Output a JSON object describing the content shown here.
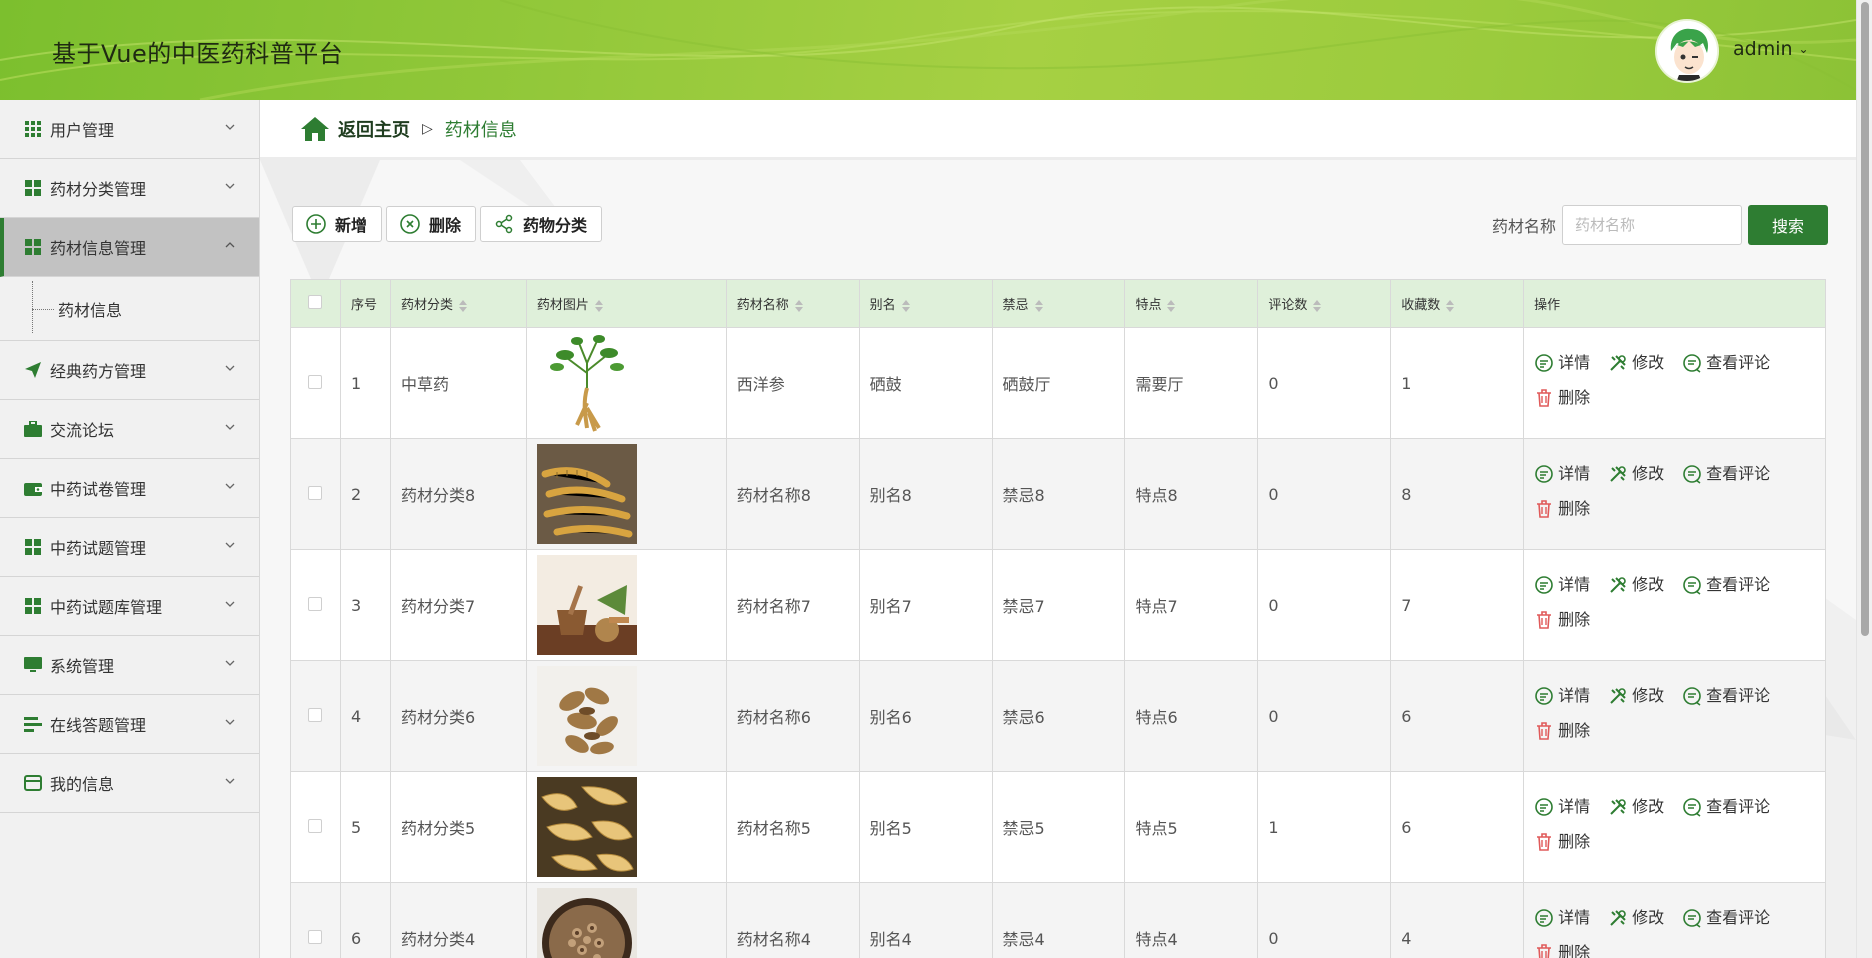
{
  "header": {
    "title": "基于Vue的中医药科普平台",
    "username": "admin"
  },
  "sidebar": {
    "items": [
      {
        "label": "用户管理",
        "icon": "grid-icon"
      },
      {
        "label": "药材分类管理",
        "icon": "grid-icon"
      },
      {
        "label": "药材信息管理",
        "icon": "grid-icon",
        "active": true
      },
      {
        "label": "经典药方管理",
        "icon": "send-icon"
      },
      {
        "label": "交流论坛",
        "icon": "briefcase-icon"
      },
      {
        "label": "中药试卷管理",
        "icon": "wallet-icon"
      },
      {
        "label": "中药试题管理",
        "icon": "grid-icon"
      },
      {
        "label": "中药试题库管理",
        "icon": "grid-icon"
      },
      {
        "label": "系统管理",
        "icon": "monitor-icon"
      },
      {
        "label": "在线答题管理",
        "icon": "list-icon"
      },
      {
        "label": "我的信息",
        "icon": "card-icon"
      }
    ],
    "sub_item": "药材信息"
  },
  "breadcrumb": {
    "home": "返回主页",
    "separator": "▷",
    "current": "药材信息"
  },
  "toolbar": {
    "add": "新增",
    "delete": "删除",
    "category": "药物分类"
  },
  "search": {
    "label": "药材名称",
    "placeholder": "药材名称",
    "button": "搜索"
  },
  "table": {
    "headers": [
      "序号",
      "药材分类",
      "药材图片",
      "药材名称",
      "别名",
      "禁忌",
      "特点",
      "评论数",
      "收藏数",
      "操作"
    ],
    "ops": {
      "detail": "详情",
      "edit": "修改",
      "comments": "查看评论",
      "delete": "删除"
    },
    "rows": [
      {
        "no": "1",
        "category": "中草药",
        "image": "ginseng-plant",
        "name": "西洋参",
        "alias": "硒鼓",
        "taboo": "硒鼓厅",
        "feature": "需要厅",
        "comments": "0",
        "favorites": "1"
      },
      {
        "no": "2",
        "category": "药材分类8",
        "image": "cordyceps",
        "name": "药材名称8",
        "alias": "别名8",
        "taboo": "禁忌8",
        "feature": "特点8",
        "comments": "0",
        "favorites": "8"
      },
      {
        "no": "3",
        "category": "药材分类7",
        "image": "herb-mortar",
        "name": "药材名称7",
        "alias": "别名7",
        "taboo": "禁忌7",
        "feature": "特点7",
        "comments": "0",
        "favorites": "7"
      },
      {
        "no": "4",
        "category": "药材分类6",
        "image": "dried-leaves",
        "name": "药材名称6",
        "alias": "别名6",
        "taboo": "禁忌6",
        "feature": "特点6",
        "comments": "0",
        "favorites": "6"
      },
      {
        "no": "5",
        "category": "药材分类5",
        "image": "dried-slices",
        "name": "药材名称5",
        "alias": "别名5",
        "taboo": "禁忌5",
        "feature": "特点5",
        "comments": "1",
        "favorites": "6"
      },
      {
        "no": "6",
        "category": "药材分类4",
        "image": "herb-bowl",
        "name": "药材名称4",
        "alias": "别名4",
        "taboo": "禁忌4",
        "feature": "特点4",
        "comments": "0",
        "favorites": "4"
      }
    ]
  },
  "colors": {
    "primary": "#2e7d32",
    "header_green": "#9bcb3d",
    "table_header": "#dff0da"
  }
}
